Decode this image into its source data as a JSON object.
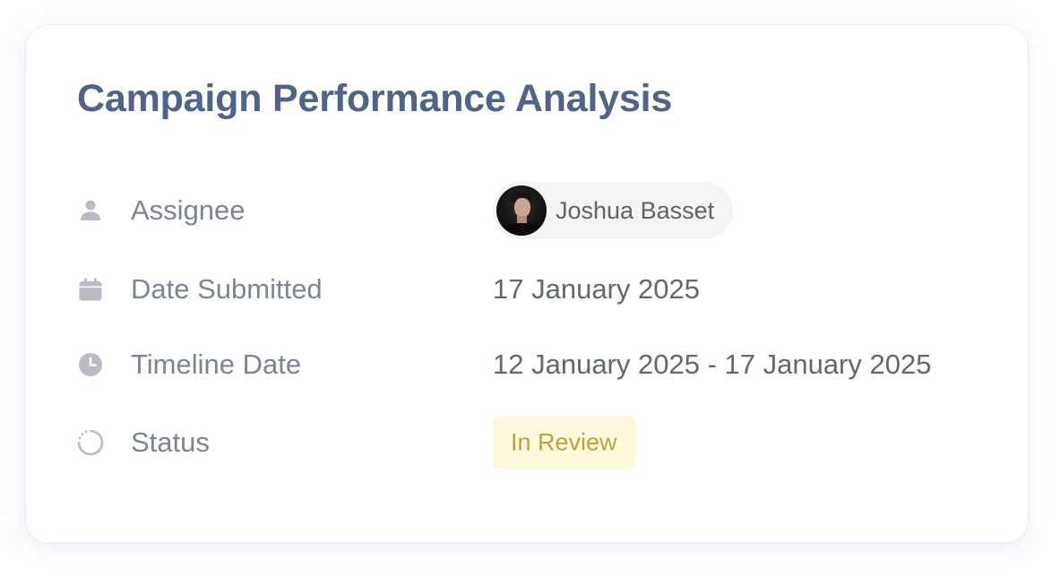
{
  "card": {
    "title": "Campaign Performance Analysis"
  },
  "fields": {
    "assignee": {
      "label": "Assignee",
      "icon": "person-icon",
      "name": "Joshua Basset"
    },
    "date_submitted": {
      "label": "Date Submitted",
      "icon": "calendar-icon",
      "value": "17 January 2025"
    },
    "timeline_date": {
      "label": "Timeline Date",
      "icon": "clock-icon",
      "value": "12 January 2025 - 17 January 2025"
    },
    "status": {
      "label": "Status",
      "icon": "spinner-icon",
      "value": "In Review"
    }
  },
  "colors": {
    "title": "#4f6489",
    "label": "#7d8595",
    "value": "#636773",
    "icon": "#b9bcc4",
    "chip_background": "#f4f4f5",
    "status_background": "#fdf9dc",
    "status_text": "#bba43a"
  }
}
